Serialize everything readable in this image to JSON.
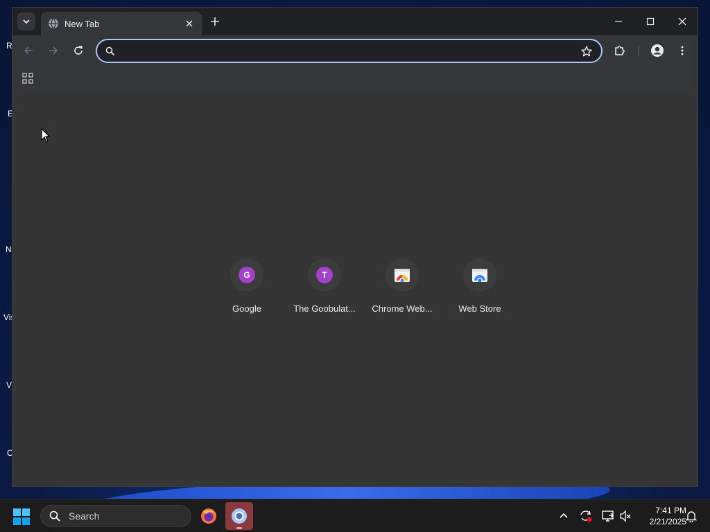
{
  "desktop": {
    "icon_labels": [
      "Re",
      "E",
      "N",
      "Vis",
      "V",
      "C"
    ]
  },
  "browser": {
    "tab_title": "New Tab",
    "omnibox_value": "",
    "accent_color": "#a8c7fa",
    "shortcuts": [
      {
        "label": "Google",
        "letter": "G"
      },
      {
        "label": "The Goobulat...",
        "letter": "T"
      },
      {
        "label": "Chrome Web...",
        "icon": "chrome-webstore-icon"
      },
      {
        "label": "Web Store",
        "icon": "webstore-icon"
      }
    ]
  },
  "taskbar": {
    "search_label": "Search",
    "time": "7:41 PM",
    "date": "2/21/2025"
  }
}
